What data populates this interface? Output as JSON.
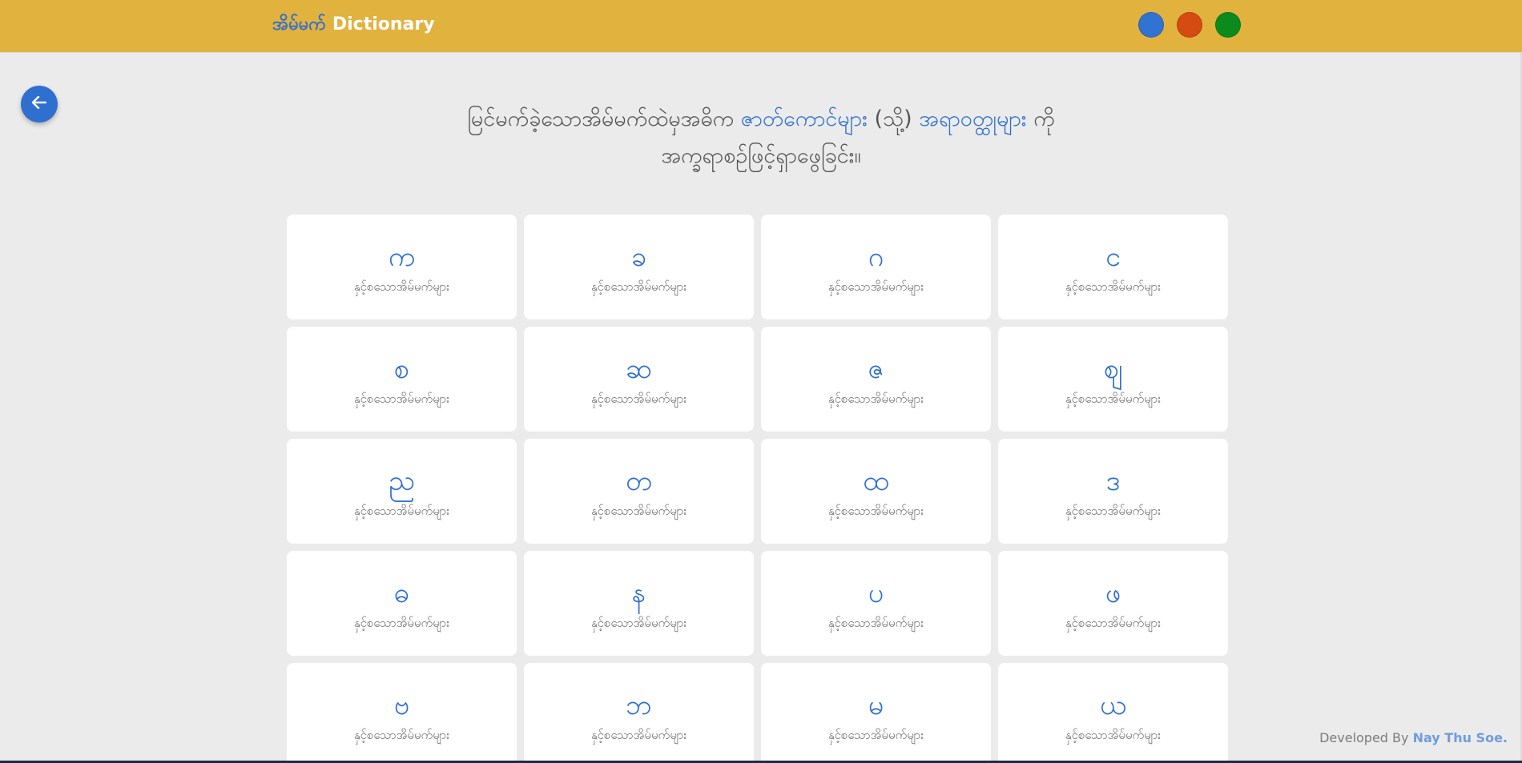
{
  "header": {
    "brand_mm": "အိမ်မက်",
    "brand_en": "Dictionary",
    "theme_colors": [
      "#3272d2",
      "#d64b12",
      "#0c8a1c"
    ]
  },
  "back_button": {
    "icon": "arrow-left-icon",
    "color": "#2f6fd0"
  },
  "headline": {
    "part1": "မြင်မက်ခဲ့သောအိမ်မက်ထဲမှအဓိက",
    "highlight1": "ဇာတ်ကောင်များ",
    "part2": "(သို့)",
    "highlight2": "အရာဝတ္ထုများ",
    "part3": "ကို",
    "line2": "အက္ခရာစဉ်ဖြင့်ရှာဖွေခြင်း။"
  },
  "cards": [
    {
      "letter": "က",
      "sub": "နှင့်စသောအိမ်မက်များ"
    },
    {
      "letter": "ခ",
      "sub": "နှင့်စသောအိမ်မက်များ"
    },
    {
      "letter": "ဂ",
      "sub": "နှင့်စသောအိမ်မက်များ"
    },
    {
      "letter": "င",
      "sub": "နှင့်စသောအိမ်မက်များ"
    },
    {
      "letter": "စ",
      "sub": "နှင့်စသောအိမ်မက်များ"
    },
    {
      "letter": "ဆ",
      "sub": "နှင့်စသောအိမ်မက်များ"
    },
    {
      "letter": "ဇ",
      "sub": "နှင့်စသောအိမ်မက်များ"
    },
    {
      "letter": "ဈ",
      "sub": "နှင့်စသောအိမ်မက်များ"
    },
    {
      "letter": "ည",
      "sub": "နှင့်စသောအိမ်မက်များ"
    },
    {
      "letter": "တ",
      "sub": "နှင့်စသောအိမ်မက်များ"
    },
    {
      "letter": "ထ",
      "sub": "နှင့်စသောအိမ်မက်များ"
    },
    {
      "letter": "ဒ",
      "sub": "နှင့်စသောအိမ်မက်များ"
    },
    {
      "letter": "ဓ",
      "sub": "နှင့်စသောအိမ်မက်များ"
    },
    {
      "letter": "န",
      "sub": "နှင့်စသောအိမ်မက်များ"
    },
    {
      "letter": "ပ",
      "sub": "နှင့်စသောအိမ်မက်များ"
    },
    {
      "letter": "ဖ",
      "sub": "နှင့်စသောအိမ်မက်များ"
    },
    {
      "letter": "ဗ",
      "sub": "နှင့်စသောအိမ်မက်များ"
    },
    {
      "letter": "ဘ",
      "sub": "နှင့်စသောအိမ်မက်များ"
    },
    {
      "letter": "မ",
      "sub": "နှင့်စသောအိမ်မက်များ"
    },
    {
      "letter": "ယ",
      "sub": "နှင့်စသောအိမ်မက်များ"
    }
  ],
  "footer": {
    "prefix": "Developed By",
    "developer": "Nay Thu Soe."
  }
}
